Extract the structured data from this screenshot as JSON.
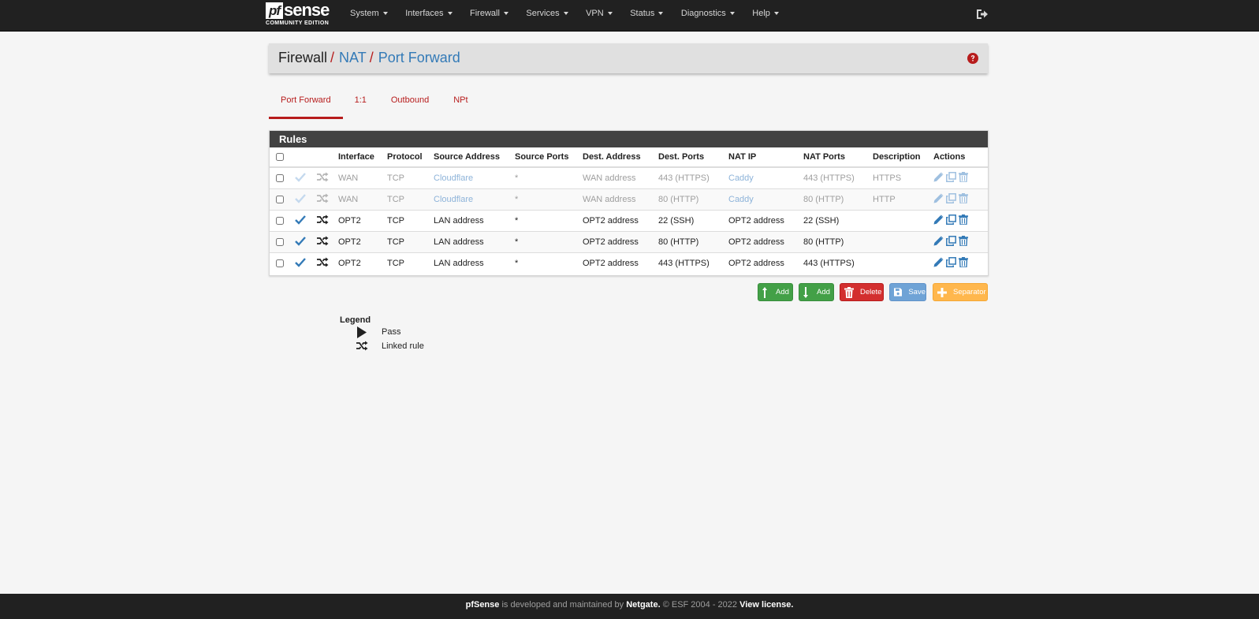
{
  "brand": {
    "logo_pf": "pf",
    "logo_sense": "sense",
    "logo_sub": "COMMUNITY EDITION"
  },
  "nav": {
    "items": [
      {
        "label": "System"
      },
      {
        "label": "Interfaces"
      },
      {
        "label": "Firewall"
      },
      {
        "label": "Services"
      },
      {
        "label": "VPN"
      },
      {
        "label": "Status"
      },
      {
        "label": "Diagnostics"
      },
      {
        "label": "Help"
      }
    ],
    "logout_icon": "sign-out-icon"
  },
  "breadcrumb": {
    "items": [
      "Firewall",
      "NAT",
      "Port Forward"
    ],
    "separator": "/",
    "help_icon": "question-circle-icon"
  },
  "tabs": [
    {
      "label": "Port Forward",
      "active": true
    },
    {
      "label": "1:1",
      "active": false
    },
    {
      "label": "Outbound",
      "active": false
    },
    {
      "label": "NPt",
      "active": false
    }
  ],
  "rules": {
    "heading": "Rules",
    "columns": [
      "Interface",
      "Protocol",
      "Source Address",
      "Source Ports",
      "Dest. Address",
      "Dest. Ports",
      "NAT IP",
      "NAT Ports",
      "Description",
      "Actions"
    ],
    "rows": [
      {
        "enabled": false,
        "interface": "WAN",
        "protocol": "TCP",
        "source_address": "Cloudflare",
        "source_ports": "*",
        "dest_address": "WAN address",
        "dest_ports": "443 (HTTPS)",
        "nat_ip": "Caddy",
        "nat_ports": "443 (HTTPS)",
        "description": "HTTPS"
      },
      {
        "enabled": false,
        "interface": "WAN",
        "protocol": "TCP",
        "source_address": "Cloudflare",
        "source_ports": "*",
        "dest_address": "WAN address",
        "dest_ports": "80 (HTTP)",
        "nat_ip": "Caddy",
        "nat_ports": "80 (HTTP)",
        "description": "HTTP"
      },
      {
        "enabled": true,
        "interface": "OPT2",
        "protocol": "TCP",
        "source_address": "LAN address",
        "source_ports": "*",
        "dest_address": "OPT2 address",
        "dest_ports": "22 (SSH)",
        "nat_ip": "OPT2 address",
        "nat_ports": "22 (SSH)",
        "description": ""
      },
      {
        "enabled": true,
        "interface": "OPT2",
        "protocol": "TCP",
        "source_address": "LAN address",
        "source_ports": "*",
        "dest_address": "OPT2 address",
        "dest_ports": "80 (HTTP)",
        "nat_ip": "OPT2 address",
        "nat_ports": "80 (HTTP)",
        "description": ""
      },
      {
        "enabled": true,
        "interface": "OPT2",
        "protocol": "TCP",
        "source_address": "LAN address",
        "source_ports": "*",
        "dest_address": "OPT2 address",
        "dest_ports": "443 (HTTPS)",
        "nat_ip": "OPT2 address",
        "nat_ports": "443 (HTTPS)",
        "description": ""
      }
    ],
    "row_icons": [
      "check-icon",
      "random-linked-icon",
      "pencil-icon",
      "clone-icon",
      "trash-icon"
    ]
  },
  "buttons": {
    "add_top": "Add",
    "add_bottom": "Add",
    "delete": "Delete",
    "save": "Save",
    "separator": "Separator"
  },
  "legend": {
    "title": "Legend",
    "items": [
      {
        "icon": "play-icon",
        "label": "Pass"
      },
      {
        "icon": "random-icon",
        "label": "Linked rule"
      }
    ]
  },
  "footer": {
    "brand": "pfSense",
    "text1": " is developed and maintained by ",
    "company": "Netgate.",
    "text2": " © ESF 2004 - 2022 ",
    "license": "View license."
  },
  "colors": {
    "navbar": "#212121",
    "accent_red": "#b71c1c",
    "link_blue": "#337ab7",
    "green": "#43a047",
    "orange": "#ffb74d"
  }
}
